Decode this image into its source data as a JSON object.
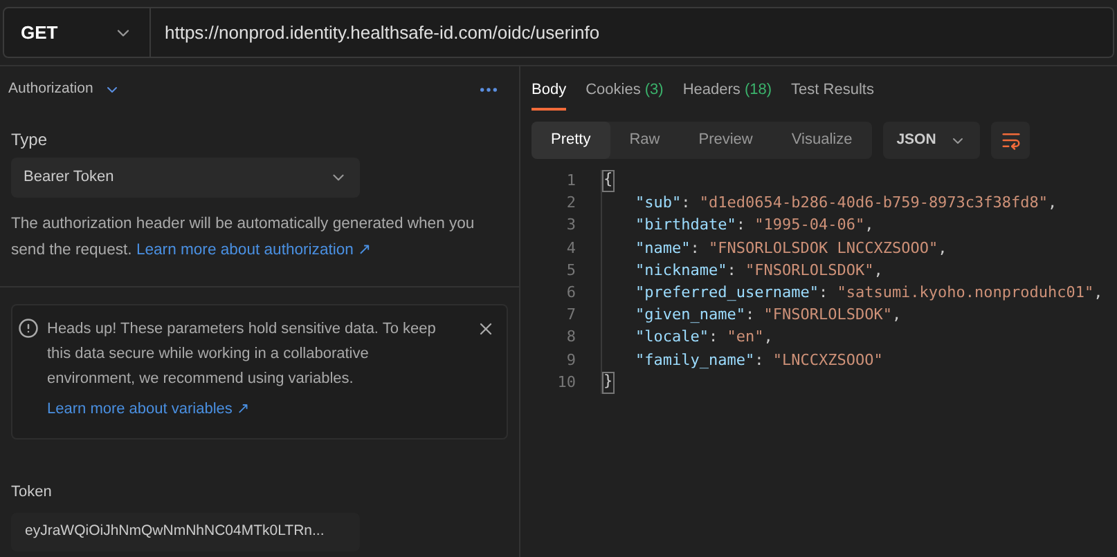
{
  "request": {
    "method": "GET",
    "url": "https://nonprod.identity.healthsafe-id.com/oidc/userinfo"
  },
  "auth": {
    "section_title": "Authorization",
    "type_label": "Type",
    "type_value": "Bearer Token",
    "description": "The authorization header will be automatically generated when you send the request.",
    "description_link": "Learn more about authorization ↗",
    "alert": {
      "text": "Heads up! These parameters hold sensitive data. To keep this data secure while working in a collaborative environment, we recommend using variables.",
      "link": "Learn more about variables ↗"
    },
    "token_label": "Token",
    "token_value": "eyJraWQiOiJhNmQwNmNhNC04MTk0LTRn..."
  },
  "response": {
    "tabs": [
      {
        "label": "Body",
        "selected": true
      },
      {
        "label": "Cookies",
        "count": "(3)",
        "selected": false
      },
      {
        "label": "Headers",
        "count": "(18)",
        "selected": false
      },
      {
        "label": "Test Results",
        "selected": false
      }
    ],
    "views": [
      {
        "label": "Pretty",
        "selected": true
      },
      {
        "label": "Raw",
        "selected": false
      },
      {
        "label": "Preview",
        "selected": false
      },
      {
        "label": "Visualize",
        "selected": false
      }
    ],
    "format": "JSON",
    "lines": [
      {
        "number": "1",
        "tokens": [
          {
            "kind": "brace",
            "text": "{"
          }
        ]
      },
      {
        "number": "2",
        "tokens": [
          {
            "kind": "key",
            "text": "\"sub\""
          },
          {
            "kind": "punct",
            "text": ": "
          },
          {
            "kind": "string",
            "text": "\"d1ed0654-b286-40d6-b759-8973c3f38fd8\""
          },
          {
            "kind": "punct",
            "text": ","
          }
        ]
      },
      {
        "number": "3",
        "tokens": [
          {
            "kind": "key",
            "text": "\"birthdate\""
          },
          {
            "kind": "punct",
            "text": ": "
          },
          {
            "kind": "string",
            "text": "\"1995-04-06\""
          },
          {
            "kind": "punct",
            "text": ","
          }
        ]
      },
      {
        "number": "4",
        "tokens": [
          {
            "kind": "key",
            "text": "\"name\""
          },
          {
            "kind": "punct",
            "text": ": "
          },
          {
            "kind": "string",
            "text": "\"FNSORLOLSDOK LNCCXZSOOO\""
          },
          {
            "kind": "punct",
            "text": ","
          }
        ]
      },
      {
        "number": "5",
        "tokens": [
          {
            "kind": "key",
            "text": "\"nickname\""
          },
          {
            "kind": "punct",
            "text": ": "
          },
          {
            "kind": "string",
            "text": "\"FNSORLOLSDOK\""
          },
          {
            "kind": "punct",
            "text": ","
          }
        ]
      },
      {
        "number": "6",
        "tokens": [
          {
            "kind": "key",
            "text": "\"preferred_username\""
          },
          {
            "kind": "punct",
            "text": ": "
          },
          {
            "kind": "string",
            "text": "\"satsumi.kyoho.nonproduhc01\""
          },
          {
            "kind": "punct",
            "text": ","
          }
        ]
      },
      {
        "number": "7",
        "tokens": [
          {
            "kind": "key",
            "text": "\"given_name\""
          },
          {
            "kind": "punct",
            "text": ": "
          },
          {
            "kind": "string",
            "text": "\"FNSORLOLSDOK\""
          },
          {
            "kind": "punct",
            "text": ","
          }
        ]
      },
      {
        "number": "8",
        "tokens": [
          {
            "kind": "key",
            "text": "\"locale\""
          },
          {
            "kind": "punct",
            "text": ": "
          },
          {
            "kind": "string",
            "text": "\"en\""
          },
          {
            "kind": "punct",
            "text": ","
          }
        ]
      },
      {
        "number": "9",
        "tokens": [
          {
            "kind": "key",
            "text": "\"family_name\""
          },
          {
            "kind": "punct",
            "text": ": "
          },
          {
            "kind": "string",
            "text": "\"LNCCXZSOOO\""
          }
        ]
      },
      {
        "number": "10",
        "tokens": [
          {
            "kind": "brace",
            "text": "}"
          }
        ]
      }
    ]
  }
}
